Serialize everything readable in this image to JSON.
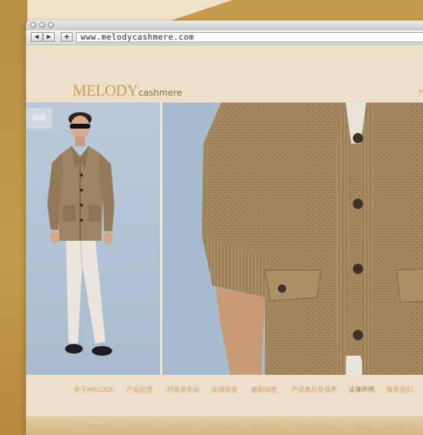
{
  "browser": {
    "url": "www.melodycashmere.com",
    "back_icon": "◀",
    "forward_icon": "▶",
    "new_tab_icon": "+"
  },
  "site": {
    "logo_main": "MELODY",
    "logo_sub": "cashmere",
    "header_edge_text": "H"
  },
  "hero": {
    "back_label": "返回"
  },
  "nav": {
    "items": [
      {
        "label": "关于MELODY"
      },
      {
        "label": "产品欣赏"
      },
      {
        "label": "时装发布会"
      },
      {
        "label": "店铺信息"
      },
      {
        "label": "最新动态"
      },
      {
        "label": "产品售后及保养"
      },
      {
        "label": "法律声明"
      },
      {
        "label": "联系我们"
      }
    ],
    "active_index": 6
  },
  "colors": {
    "page_bg": "#eddfca",
    "accent_gold": "#c8a058",
    "nav_text": "#c6a36a",
    "sky_blue": "#a9bccd",
    "knit": "#9a7e57"
  }
}
